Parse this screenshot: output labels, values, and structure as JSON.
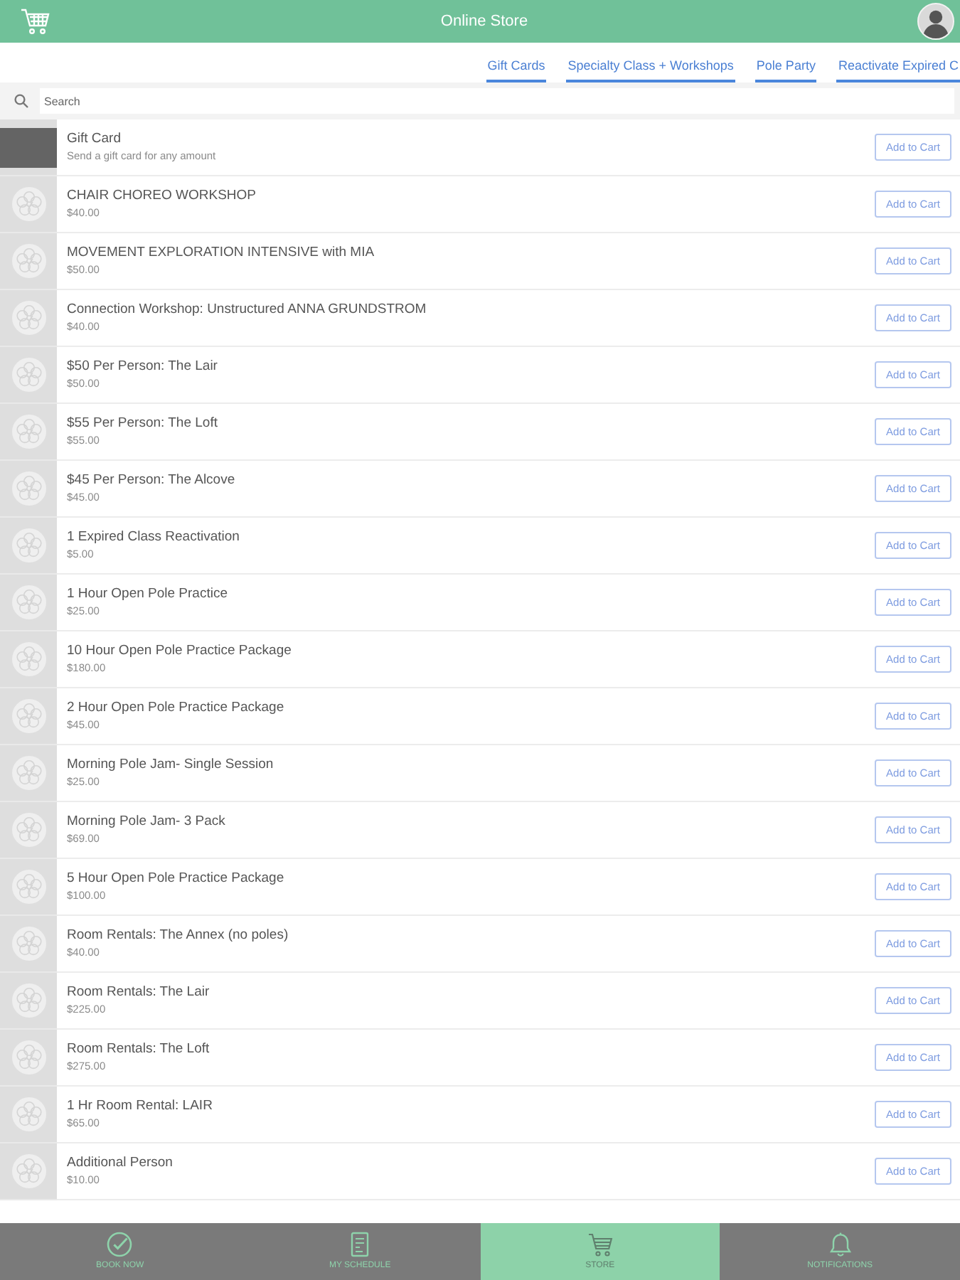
{
  "header": {
    "title": "Online Store"
  },
  "category_tabs": [
    {
      "label": "Gift Cards"
    },
    {
      "label": "Specialty Class + Workshops"
    },
    {
      "label": "Pole Party"
    },
    {
      "label": "Reactivate Expired C"
    }
  ],
  "search": {
    "placeholder": "Search"
  },
  "products": [
    {
      "kind": "gift-card",
      "name": "Gift Card",
      "detail": "Send a gift card for any amount",
      "button": "Add to Cart"
    },
    {
      "kind": "item",
      "name": "CHAIR CHOREO WORKSHOP",
      "detail": "$40.00",
      "button": "Add to Cart"
    },
    {
      "kind": "item",
      "name": "MOVEMENT EXPLORATION INTENSIVE with MIA",
      "detail": "$50.00",
      "button": "Add to Cart"
    },
    {
      "kind": "item",
      "name": "Connection Workshop: Unstructured ANNA GRUNDSTROM",
      "detail": "$40.00",
      "button": "Add to Cart"
    },
    {
      "kind": "item",
      "name": "$50 Per Person: The Lair",
      "detail": "$50.00",
      "button": "Add to Cart"
    },
    {
      "kind": "item",
      "name": "$55 Per Person: The Loft",
      "detail": "$55.00",
      "button": "Add to Cart"
    },
    {
      "kind": "item",
      "name": "$45 Per Person: The Alcove",
      "detail": "$45.00",
      "button": "Add to Cart"
    },
    {
      "kind": "item",
      "name": "1 Expired Class Reactivation",
      "detail": "$5.00",
      "button": "Add to Cart"
    },
    {
      "kind": "item",
      "name": "1 Hour Open Pole Practice",
      "detail": "$25.00",
      "button": "Add to Cart"
    },
    {
      "kind": "item",
      "name": "10 Hour Open Pole Practice Package",
      "detail": "$180.00",
      "button": "Add to Cart"
    },
    {
      "kind": "item",
      "name": "2 Hour Open Pole Practice Package",
      "detail": "$45.00",
      "button": "Add to Cart"
    },
    {
      "kind": "item",
      "name": "Morning Pole Jam- Single Session",
      "detail": "$25.00",
      "button": "Add to Cart"
    },
    {
      "kind": "item",
      "name": "Morning Pole Jam- 3 Pack",
      "detail": "$69.00",
      "button": "Add to Cart"
    },
    {
      "kind": "item",
      "name": "5 Hour Open Pole Practice Package",
      "detail": "$100.00",
      "button": "Add to Cart"
    },
    {
      "kind": "item",
      "name": "Room Rentals: The Annex (no poles)",
      "detail": "$40.00",
      "button": "Add to Cart"
    },
    {
      "kind": "item",
      "name": "Room Rentals: The Lair",
      "detail": "$225.00",
      "button": "Add to Cart"
    },
    {
      "kind": "item",
      "name": "Room Rentals: The Loft",
      "detail": "$275.00",
      "button": "Add to Cart"
    },
    {
      "kind": "item",
      "name": "1 Hr Room Rental: LAIR",
      "detail": "$65.00",
      "button": "Add to Cart"
    },
    {
      "kind": "item",
      "name": "Additional Person",
      "detail": "$10.00",
      "button": "Add to Cart"
    }
  ],
  "bottom_tabs": [
    {
      "kind": "book",
      "label": "BOOK NOW",
      "selected": false
    },
    {
      "kind": "schedule",
      "label": "MY SCHEDULE",
      "selected": false
    },
    {
      "kind": "store",
      "label": "STORE",
      "selected": true
    },
    {
      "kind": "notifications",
      "label": "NOTIFICATIONS",
      "selected": false
    }
  ]
}
